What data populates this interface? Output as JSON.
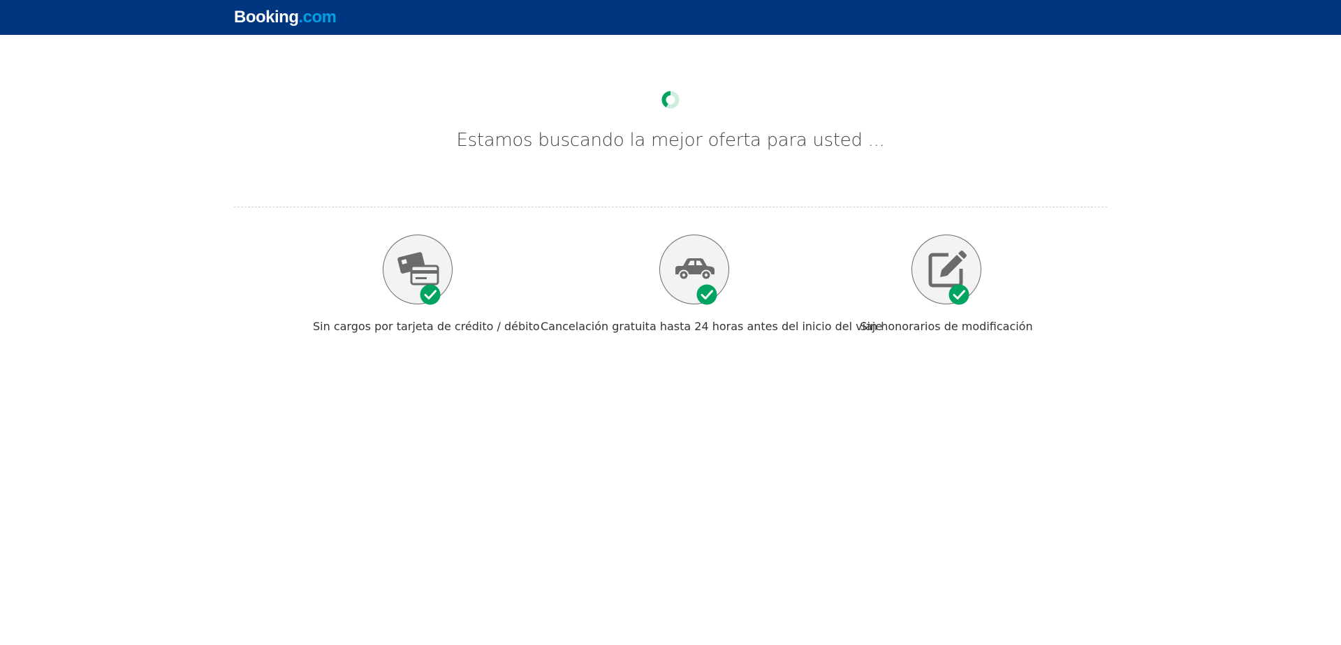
{
  "header": {
    "logo_main": "Booking",
    "logo_suffix": ".com"
  },
  "loading": {
    "message": "Estamos buscando la mejor oferta para usted ..."
  },
  "features": [
    {
      "icon": "credit-card-icon",
      "label": "Sin cargos por tarjeta de crédito / débito"
    },
    {
      "icon": "car-icon",
      "label": "Cancelación gratuita hasta 24 horas antes del inicio del viaje"
    },
    {
      "icon": "edit-icon",
      "label": "Sin honorarios de modificación"
    }
  ],
  "colors": {
    "header_bg": "#003580",
    "logo_accent": "#009fe3",
    "check_green": "#00a35f",
    "icon_gray": "#6b6b6b"
  }
}
